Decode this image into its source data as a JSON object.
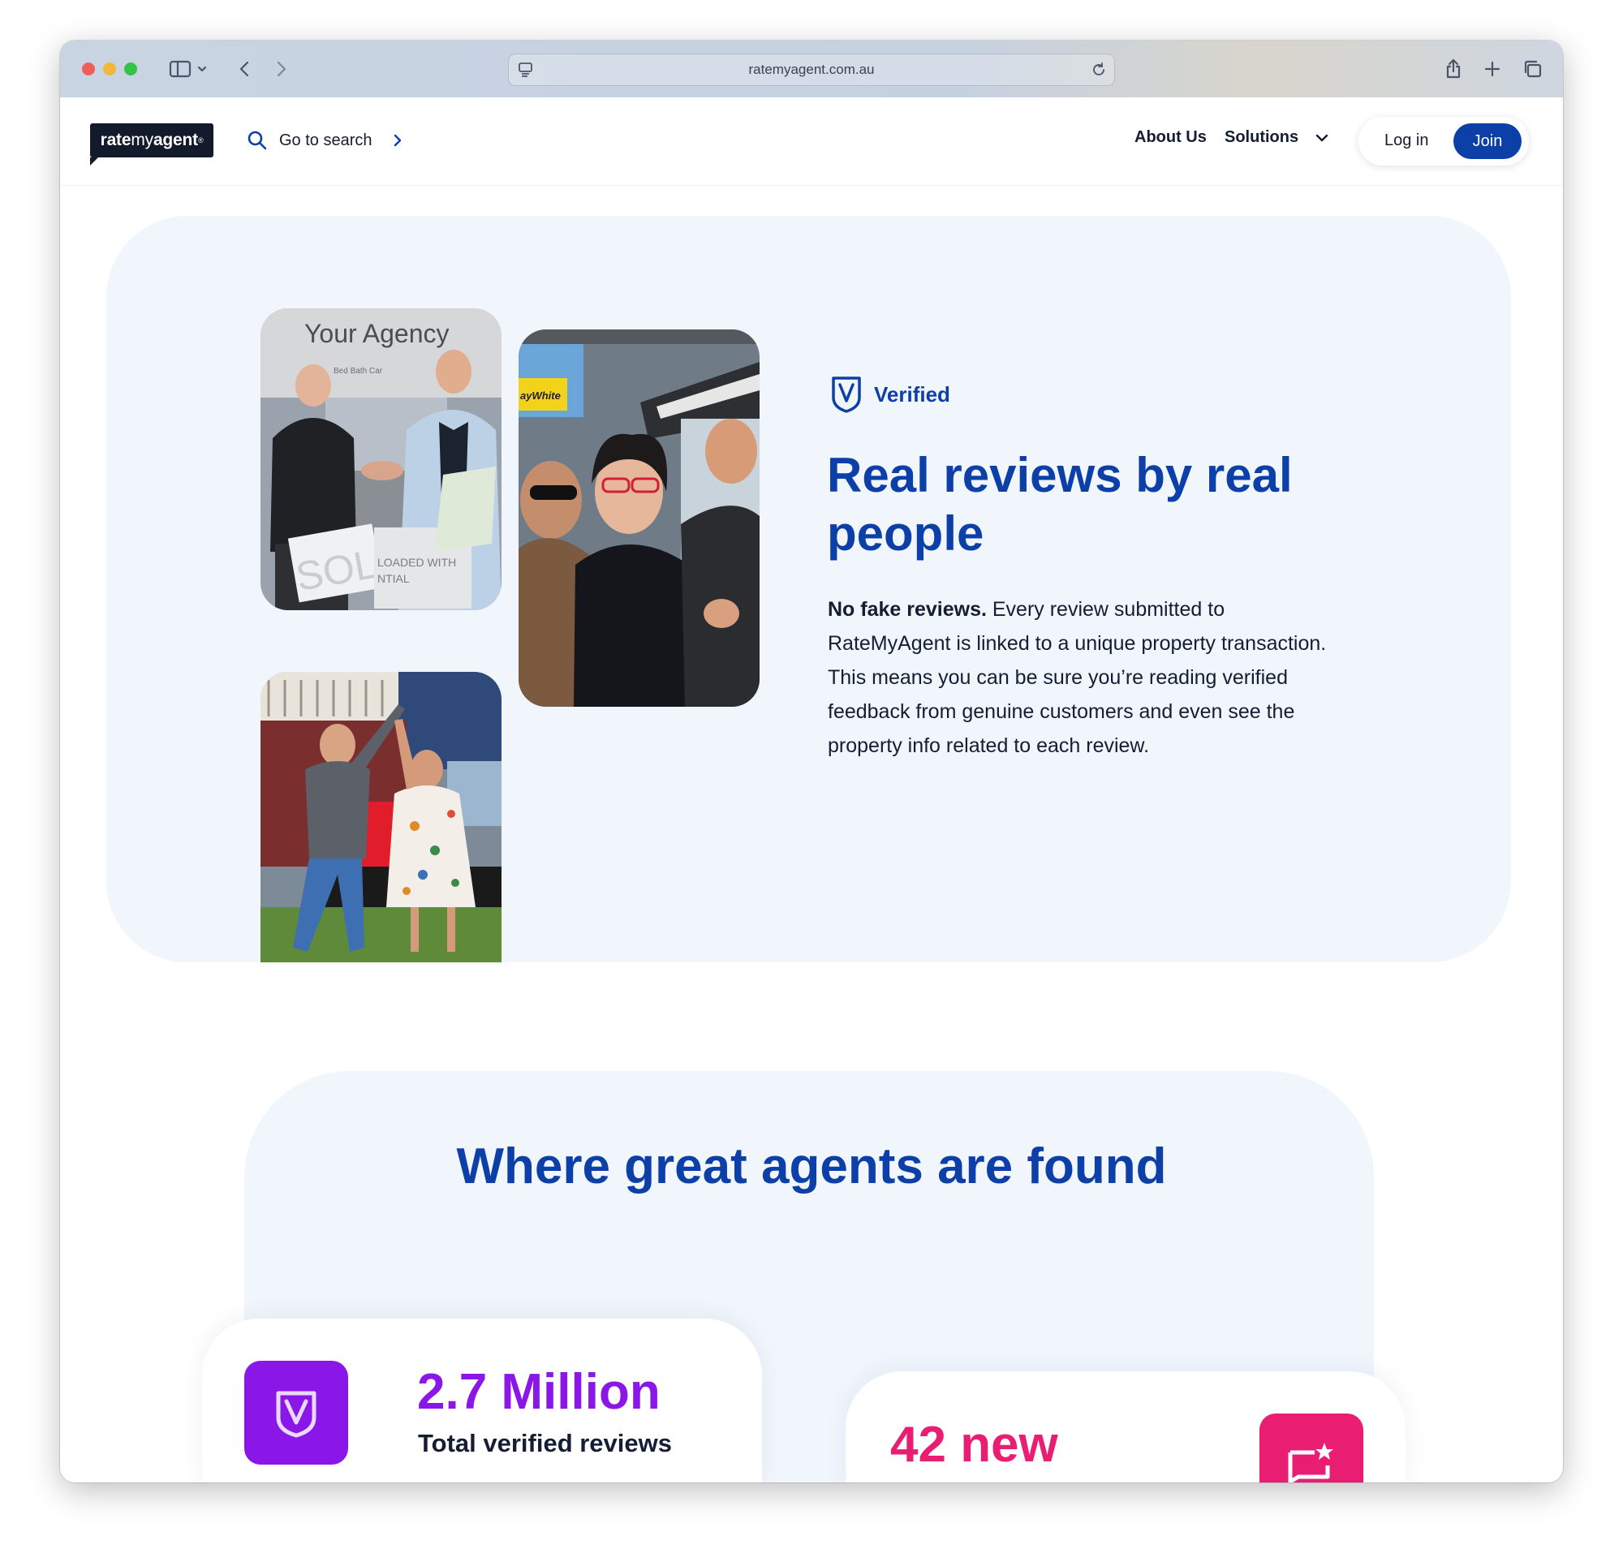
{
  "browser": {
    "url": "ratemyagent.com.au"
  },
  "header": {
    "logo": {
      "bold": "rate",
      "light": "my",
      "bold2": "agent",
      "mark": "®"
    },
    "search_label": "Go to search",
    "nav_about": "About Us",
    "nav_solutions": "Solutions",
    "login_label": "Log in",
    "join_label": "Join"
  },
  "verified_section": {
    "badge_label": "Verified",
    "title": "Real reviews by real people",
    "body_bold": "No fake reviews.",
    "body_p1": " Every review submitted to RateMyAgent is linked to a unique property transaction.",
    "body_p2": "This means you can be sure you’re reading verified feedback from genuine customers and even see the property info related to each review.",
    "photo1_sign_text": "Your Agency",
    "photo1_sign_sub": "Bed   Bath   Car",
    "photo1_board_text": "SOLD",
    "photo1_board_sub": "LOADED WITH",
    "photo1_board_sub2": "NTIAL",
    "photo2_brand": "ayWhite"
  },
  "found_section": {
    "title": "Where great agents are found",
    "stats": [
      {
        "value": "2.7 Million",
        "label": "Total verified reviews",
        "color": "#8a17e8"
      },
      {
        "value": "42 new",
        "label": "",
        "color": "#e91e73"
      }
    ]
  },
  "colors": {
    "brand_blue": "#0d3fa8",
    "section_bg": "#f1f6fd",
    "purple": "#8a17e8",
    "pink": "#e91e73"
  }
}
